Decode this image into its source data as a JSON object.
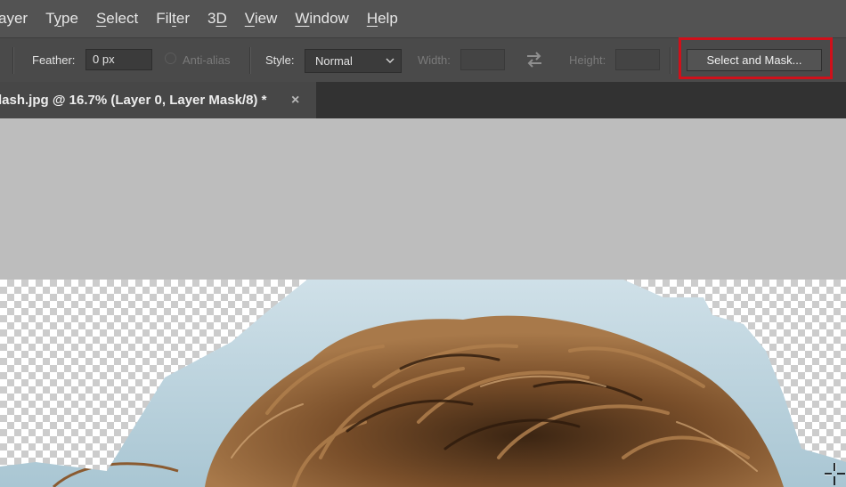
{
  "menu": [
    {
      "label": "ayer",
      "underline": ""
    },
    {
      "label": "Type",
      "underline": "y"
    },
    {
      "label": "Select",
      "underline": "S"
    },
    {
      "label": "Filter",
      "underline": "t"
    },
    {
      "label": "3D",
      "underline": "D"
    },
    {
      "label": "View",
      "underline": "V"
    },
    {
      "label": "Window",
      "underline": "W"
    },
    {
      "label": "Help",
      "underline": "H"
    }
  ],
  "options": {
    "feather_label": "Feather:",
    "feather_value": "0 px",
    "antialias_label": "Anti-alias",
    "style_label": "Style:",
    "style_value": "Normal",
    "width_label": "Width:",
    "width_value": "",
    "height_label": "Height:",
    "height_value": "",
    "select_and_mask_label": "Select and Mask...",
    "highlight_color": "#d0101a"
  },
  "document_tab": {
    "title": "lash.jpg @ 16.7% (Layer 0, Layer Mask/8) *",
    "close_glyph": "×"
  },
  "icons": {
    "swap": "swap-arrows-icon",
    "dropdown": "chevron-down-icon",
    "cursor": "crosshair-cursor-icon"
  }
}
